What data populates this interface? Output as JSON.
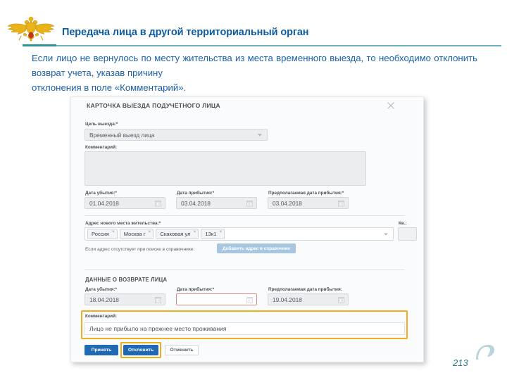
{
  "slide": {
    "emblem_icon": "russian-mvd-eagle-emblem",
    "title": "Передача лица в другой территориальный орган",
    "paragraph": "Если лицо не вернулось по месту жительства из места временного выезда, то необходимо отклонить возврат учета, указав причину",
    "paragraph_last_line": "отклонения в поле «Комментарий».",
    "page_number": "213",
    "colors": {
      "title": "#0f5ba0",
      "rule": "#6fb3ba",
      "body_text": "#1a5fa8",
      "page_number": "#2c7a86",
      "highlight": "#f2ad1a",
      "primary_button": "#1f68b5"
    }
  },
  "dialog": {
    "title": "КАРТОЧКА ВЫЕЗДА ПОДУЧЁТНОГО ЛИЦА",
    "close_icon": "close-icon",
    "purpose": {
      "label": "Цель выезда:",
      "required_mark": "*",
      "value": "Временный выезд лица",
      "caret_icon": "chevron-down-icon"
    },
    "comment_top": {
      "label": "Комментарий:",
      "value": ""
    },
    "trip_dates": {
      "departure": {
        "label": "Дата убытия:",
        "required_mark": "*",
        "value": "01.04.2018",
        "calendar_icon": "calendar-icon"
      },
      "arrival": {
        "label": "Дата прибытия:",
        "required_mark": "*",
        "value": "03.04.2018",
        "calendar_icon": "calendar-icon"
      },
      "expected_arrival": {
        "label": "Предполагаемая дата прибытия:",
        "required_mark": "*",
        "value": "03.04.2018",
        "calendar_icon": "calendar-icon"
      }
    },
    "address": {
      "label": "Адрес нового места жительства:",
      "required_mark": "*",
      "tags": [
        {
          "text": "Россия",
          "remove_icon": "×"
        },
        {
          "text": "Москва г",
          "remove_icon": "×"
        },
        {
          "text": "Скаковая ул",
          "remove_icon": "×"
        },
        {
          "text": "13к1",
          "remove_icon": "×"
        }
      ],
      "caret_icon": "chevron-down-icon",
      "apartment_label": "Кв.:",
      "apartment_value": "",
      "hint": "Если адрес отсутствует при поиске в справочнике:",
      "add_button": "Добавить адрес в справочник"
    },
    "return_section": {
      "heading": "ДАННЫЕ О ВОЗВРАТЕ ЛИЦА",
      "departure": {
        "label": "Дата убытия:",
        "required_mark": "*",
        "value": "18.04.2018",
        "calendar_icon": "calendar-icon"
      },
      "arrival": {
        "label": "Дата прибытия:",
        "required_mark": "*",
        "value": "",
        "calendar_icon": "calendar-icon",
        "state": "invalid-empty"
      },
      "expected_arrival": {
        "label": "Предполагаемая дата прибытия:",
        "required_mark": "",
        "value": "19.04.2018",
        "calendar_icon": "calendar-icon"
      },
      "comment": {
        "label": "Комментарий:",
        "value": "Лицо не прибыло на прежнее место проживания",
        "highlighted": true
      }
    },
    "actions": {
      "accept": "Принять",
      "reject": "Отклонить",
      "cancel": "Отменить",
      "highlighted": "reject"
    }
  }
}
